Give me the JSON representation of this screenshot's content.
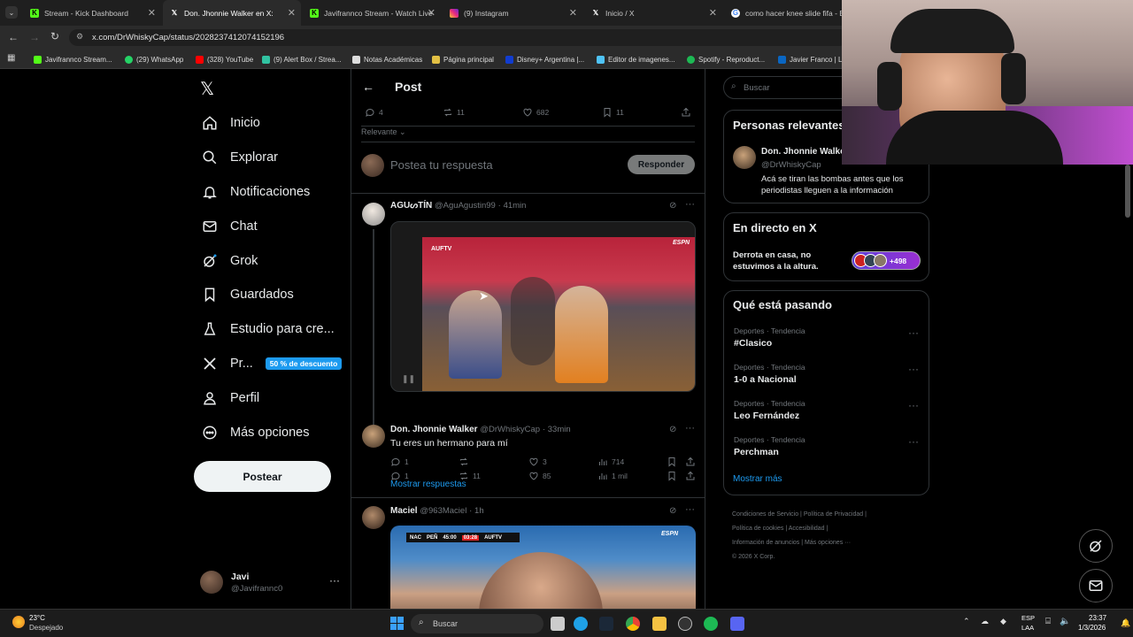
{
  "browser": {
    "tabs": [
      {
        "label": "Stream - Kick Dashboard",
        "active": false
      },
      {
        "label": "Don. Jhonnie Walker en X:",
        "active": true
      },
      {
        "label": "Javifrannco Stream - Watch Live",
        "active": false
      },
      {
        "label": "(9) Instagram",
        "active": false
      },
      {
        "label": "Inicio / X",
        "active": false
      },
      {
        "label": "como hacer knee slide fifa - Bu",
        "active": false
      }
    ],
    "url": "x.com/DrWhiskyCap/status/2028237412074152196",
    "bookmarks": [
      "Javifrannco Stream...",
      "(29) WhatsApp",
      "(328) YouTube",
      "(9) Alert Box / Strea...",
      "Notas Académicas",
      "Página principal",
      "Disney+ Argentina |...",
      "Editor de imagenes...",
      "Spotify - Reproduct...",
      "Javier Franco | Li"
    ]
  },
  "nav": {
    "items": [
      "Inicio",
      "Explorar",
      "Notificaciones",
      "Chat",
      "Grok",
      "Guardados",
      "Estudio para cre...",
      "Pr...",
      "Perfil",
      "Más opciones"
    ],
    "premium_badge": "50 % de descuento",
    "post_button": "Postear",
    "user": {
      "name": "Javi",
      "handle": "@Javifrannc0"
    }
  },
  "header": {
    "title": "Post"
  },
  "main_post_stats": {
    "replies": "4",
    "reposts": "11",
    "likes": "682",
    "bookmarks": "11"
  },
  "sort": "Relevante",
  "reply_box": {
    "placeholder": "Postea tu respuesta",
    "button": "Responder"
  },
  "replies": [
    {
      "name": "AGUᔕTÍN",
      "handle": "@AguAgustin99",
      "time": "41min",
      "text": "",
      "stats": {
        "replies": "1",
        "reposts": "11",
        "likes": "85",
        "views": "1 mil"
      },
      "video_tags": [
        "AUFTV",
        "ESPN"
      ]
    },
    {
      "name": "Don. Jhonnie Walker",
      "handle": "@DrWhiskyCap",
      "time": "33min",
      "text": "Tu eres un hermano para mí",
      "stats": {
        "replies": "1",
        "reposts": "",
        "likes": "3",
        "views": "714"
      }
    },
    {
      "name": "Maciel",
      "handle": "@963Maciel",
      "time": "1h",
      "text": "",
      "video_tags": [
        "NAC",
        "PEÑ",
        "45:00",
        "03:28",
        "AUFTV",
        "ESPN"
      ]
    }
  ],
  "show_replies": "Mostrar respuestas",
  "search": {
    "placeholder": "Buscar"
  },
  "relevant": {
    "title": "Personas relevantes",
    "person": {
      "name": "Don. Jhonnie Walker",
      "handle": "@DrWhiskyCap",
      "bio": "Acá se tiran las bombas antes que los periodistas lleguen a la información"
    }
  },
  "live": {
    "title": "En directo en X",
    "text": "Derrota en casa, no estuvimos a la altura.",
    "count": "+498"
  },
  "trends": {
    "title": "Qué está pasando",
    "items": [
      {
        "category": "Deportes · Tendencia",
        "name": "#Clasico"
      },
      {
        "category": "Deportes · Tendencia",
        "name": "1-0 a Nacional"
      },
      {
        "category": "Deportes · Tendencia",
        "name": "Leo Fernández"
      },
      {
        "category": "Deportes · Tendencia",
        "name": "Perchman"
      }
    ],
    "more": "Mostrar más"
  },
  "footer": {
    "links": [
      "Condiciones de Servicio",
      "Política de Privacidad",
      "Política de cookies",
      "Accesibilidad",
      "Información de anuncios",
      "Más opciones ···",
      "© 2026 X Corp."
    ]
  },
  "taskbar": {
    "weather_temp": "23°C",
    "weather_desc": "Despejado",
    "search": "Buscar",
    "lang": "ESP",
    "lang2": "LAA",
    "time": "23:37",
    "date": "1/3/2026"
  },
  "colors": {
    "accent": "#1d9bf0",
    "bg": "#000000",
    "border": "#2f3336",
    "muted": "#71767b"
  }
}
